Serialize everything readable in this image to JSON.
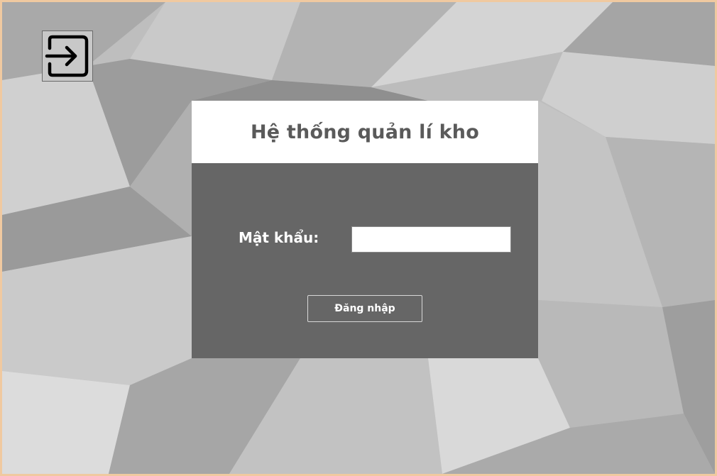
{
  "colors": {
    "panel_header_bg": "#ffffff",
    "panel_body_bg": "#666666",
    "title_text": "#5a5a5a",
    "window_border": "#f0c9a0"
  },
  "toolbar": {
    "exit_icon": "exit-arrow-icon"
  },
  "login_panel": {
    "title": "Hệ thống quản lí kho",
    "password_label": "Mật khẩu:",
    "password_value": "",
    "login_button_label": "Đăng nhập"
  }
}
